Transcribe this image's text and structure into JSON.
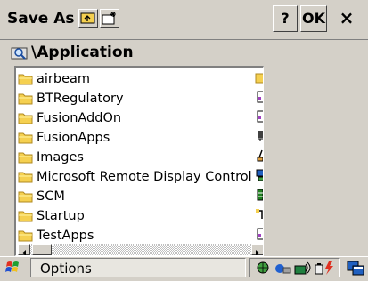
{
  "titlebar": {
    "title": "Save As",
    "help_label": "?",
    "ok_label": "OK",
    "close_label": "×"
  },
  "path": {
    "label": "\\Application"
  },
  "files": [
    {
      "name": "airbeam",
      "icon": "folder-icon"
    },
    {
      "name": "BTRegulatory",
      "icon": "folder-icon"
    },
    {
      "name": "FusionAddOn",
      "icon": "folder-icon"
    },
    {
      "name": "FusionApps",
      "icon": "folder-icon"
    },
    {
      "name": "Images",
      "icon": "folder-icon"
    },
    {
      "name": "Microsoft Remote Display Control",
      "icon": "folder-icon"
    },
    {
      "name": "SCM",
      "icon": "folder-icon"
    },
    {
      "name": "Startup",
      "icon": "folder-icon"
    },
    {
      "name": "TestApps",
      "icon": "folder-icon"
    }
  ],
  "taskbar": {
    "task_label": "Options",
    "tray_icons": [
      "network-globe-icon",
      "bluetooth-devices-icon",
      "wireless-signal-icon",
      "battery-power-icon"
    ]
  },
  "colors": {
    "folder": "#f5d050",
    "folder_dark": "#b08a20",
    "window": "#d4d0c8"
  }
}
